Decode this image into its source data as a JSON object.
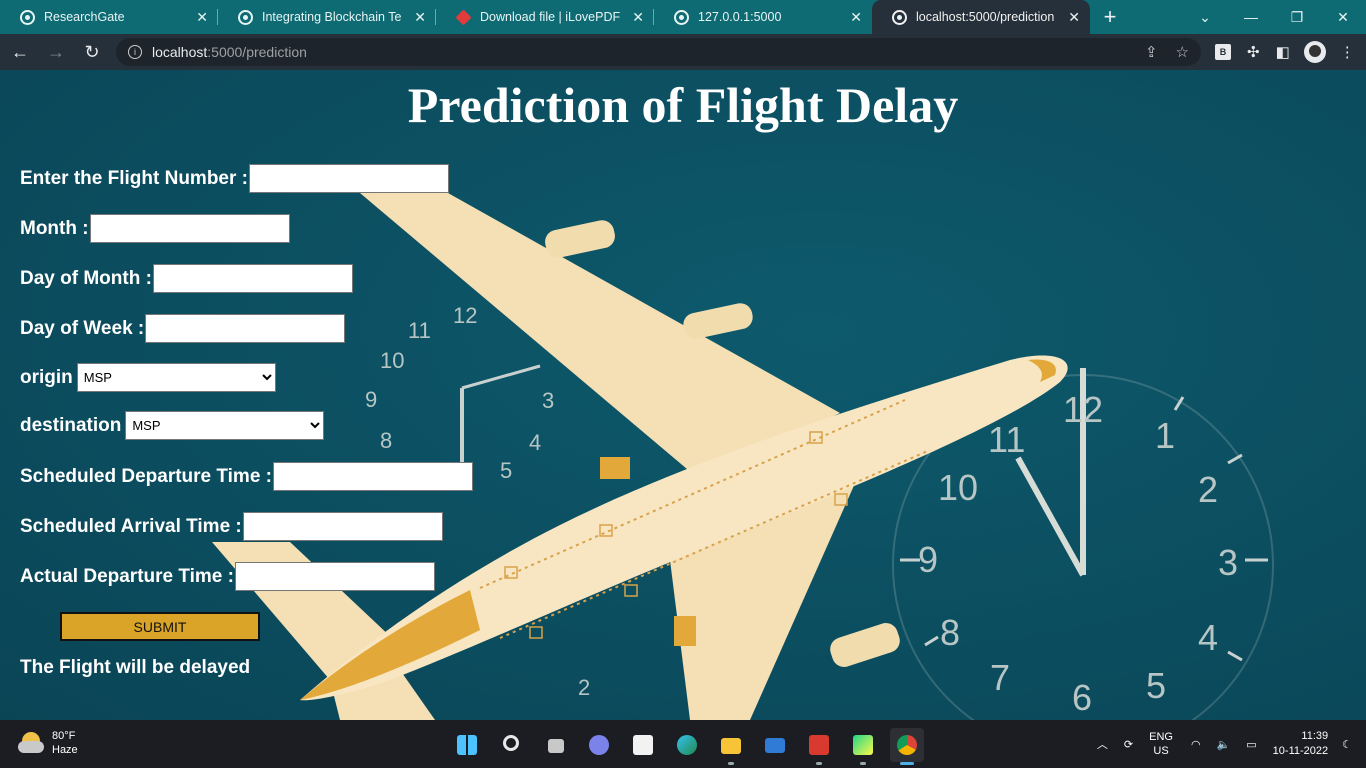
{
  "browser": {
    "tabs": [
      {
        "title": "ResearchGate",
        "icon": "globe-icon"
      },
      {
        "title": "Integrating Blockchain Techn",
        "icon": "globe-icon"
      },
      {
        "title": "Download file | iLovePDF",
        "icon": "ilovepdf-heart-icon"
      },
      {
        "title": "127.0.0.1:5000",
        "icon": "globe-icon"
      },
      {
        "title": "localhost:5000/prediction",
        "icon": "globe-icon",
        "active": true
      }
    ],
    "url_host": "localhost",
    "url_path": ":5000/prediction",
    "extension_label": "B"
  },
  "page": {
    "title": "Prediction of Flight Delay",
    "fields": {
      "flight_number": {
        "label": "Enter the Flight Number :",
        "value": ""
      },
      "month": {
        "label": "Month :",
        "value": ""
      },
      "day_of_month": {
        "label": "Day of Month :",
        "value": ""
      },
      "day_of_week": {
        "label": "Day of Week :",
        "value": ""
      },
      "origin": {
        "label": "origin",
        "selected": "MSP"
      },
      "destination": {
        "label": "destination",
        "selected": "MSP"
      },
      "scheduled_departure": {
        "label": "Scheduled Departure Time :",
        "value": ""
      },
      "scheduled_arrival": {
        "label": "Scheduled Arrival Time :",
        "value": ""
      },
      "actual_departure": {
        "label": "Actual Departure Time :",
        "value": ""
      }
    },
    "submit_label": "SUBMIT",
    "result_text": "The Flight will be delayed"
  },
  "taskbar": {
    "weather_temp": "80°F",
    "weather_desc": "Haze",
    "lang_top": "ENG",
    "lang_bottom": "US",
    "time": "11:39",
    "date": "10-11-2022"
  },
  "colors": {
    "background": "#0c5063",
    "submit": "#d9a427",
    "plane": "#f7e3bb",
    "plane_accent": "#e2a83a"
  }
}
